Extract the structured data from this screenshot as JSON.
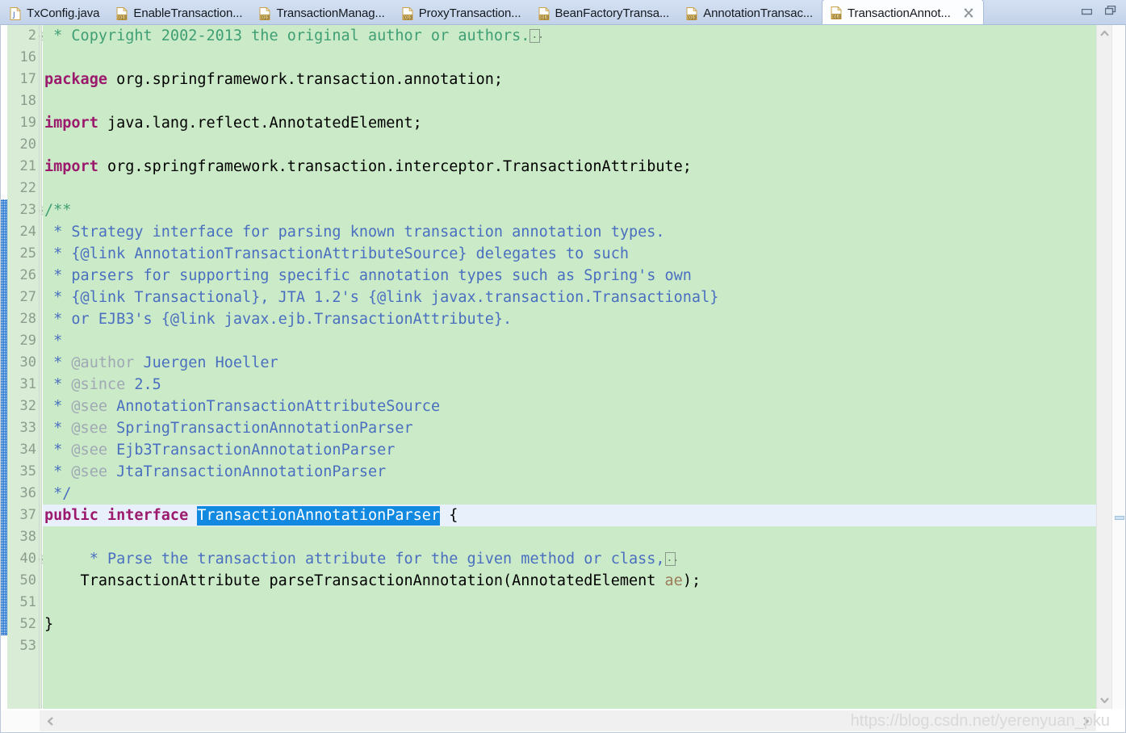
{
  "window": {
    "minimize_label": "Minimize",
    "maximize_label": "Restore"
  },
  "tabs": [
    {
      "label": "TxConfig.java",
      "icon": "java-file-icon",
      "active": false,
      "closable": false
    },
    {
      "label": "EnableTransaction...",
      "icon": "class-file-icon",
      "active": false,
      "closable": false
    },
    {
      "label": "TransactionManag...",
      "icon": "class-file-icon",
      "active": false,
      "closable": false
    },
    {
      "label": "ProxyTransaction...",
      "icon": "class-file-icon",
      "active": false,
      "closable": false
    },
    {
      "label": "BeanFactoryTransa...",
      "icon": "class-file-icon",
      "active": false,
      "closable": false
    },
    {
      "label": "AnnotationTransac...",
      "icon": "class-file-icon",
      "active": false,
      "closable": false
    },
    {
      "label": "TransactionAnnot...",
      "icon": "class-file-icon",
      "active": true,
      "closable": true
    }
  ],
  "editor": {
    "lines": [
      {
        "num": "2",
        "fold": "expand",
        "segments": [
          {
            "t": " * Copyright 2002-2013 the original author or authors.",
            "c": "cm"
          },
          {
            "t": "",
            "c": "collapsebox"
          }
        ]
      },
      {
        "num": "16",
        "fold": "",
        "segments": []
      },
      {
        "num": "17",
        "fold": "",
        "segments": [
          {
            "t": "package",
            "c": "k"
          },
          {
            "t": " org.springframework.transaction.annotation;",
            "c": "pl"
          }
        ]
      },
      {
        "num": "18",
        "fold": "",
        "segments": []
      },
      {
        "num": "19",
        "fold": "",
        "segments": [
          {
            "t": "import",
            "c": "k"
          },
          {
            "t": " java.lang.reflect.AnnotatedElement;",
            "c": "pl"
          }
        ]
      },
      {
        "num": "20",
        "fold": "",
        "segments": []
      },
      {
        "num": "21",
        "fold": "",
        "segments": [
          {
            "t": "import",
            "c": "k"
          },
          {
            "t": " org.springframework.transaction.interceptor.TransactionAttribute;",
            "c": "pl"
          }
        ]
      },
      {
        "num": "22",
        "fold": "",
        "segments": []
      },
      {
        "num": "23",
        "fold": "collapse",
        "segments": [
          {
            "t": "/**",
            "c": "cm"
          }
        ]
      },
      {
        "num": "24",
        "fold": "",
        "segments": [
          {
            "t": " * Strategy interface for parsing known transaction annotation types.",
            "c": "jd"
          }
        ]
      },
      {
        "num": "25",
        "fold": "",
        "segments": [
          {
            "t": " * {@link AnnotationTransactionAttributeSource} delegates to such",
            "c": "jd"
          }
        ]
      },
      {
        "num": "26",
        "fold": "",
        "segments": [
          {
            "t": " * parsers for supporting specific annotation types such as Spring's own",
            "c": "jd"
          }
        ]
      },
      {
        "num": "27",
        "fold": "",
        "segments": [
          {
            "t": " * {@link Transactional}, JTA 1.2's {@link javax.transaction.Transactional}",
            "c": "jd"
          }
        ]
      },
      {
        "num": "28",
        "fold": "",
        "segments": [
          {
            "t": " * or EJB3's {@link javax.ejb.TransactionAttribute}.",
            "c": "jd"
          }
        ]
      },
      {
        "num": "29",
        "fold": "",
        "segments": [
          {
            "t": " *",
            "c": "jd"
          }
        ]
      },
      {
        "num": "30",
        "fold": "",
        "segments": [
          {
            "t": " * ",
            "c": "jd"
          },
          {
            "t": "@author",
            "c": "jt"
          },
          {
            "t": " Juergen Hoeller",
            "c": "jd"
          }
        ]
      },
      {
        "num": "31",
        "fold": "",
        "segments": [
          {
            "t": " * ",
            "c": "jd"
          },
          {
            "t": "@since",
            "c": "jt"
          },
          {
            "t": " 2.5",
            "c": "jd"
          }
        ]
      },
      {
        "num": "32",
        "fold": "",
        "segments": [
          {
            "t": " * ",
            "c": "jd"
          },
          {
            "t": "@see",
            "c": "jt"
          },
          {
            "t": " AnnotationTransactionAttributeSource",
            "c": "jd"
          }
        ]
      },
      {
        "num": "33",
        "fold": "",
        "segments": [
          {
            "t": " * ",
            "c": "jd"
          },
          {
            "t": "@see",
            "c": "jt"
          },
          {
            "t": " SpringTransactionAnnotationParser",
            "c": "jd"
          }
        ]
      },
      {
        "num": "34",
        "fold": "",
        "segments": [
          {
            "t": " * ",
            "c": "jd"
          },
          {
            "t": "@see",
            "c": "jt"
          },
          {
            "t": " Ejb3TransactionAnnotationParser",
            "c": "jd"
          }
        ]
      },
      {
        "num": "35",
        "fold": "",
        "segments": [
          {
            "t": " * ",
            "c": "jd"
          },
          {
            "t": "@see",
            "c": "jt"
          },
          {
            "t": " JtaTransactionAnnotationParser",
            "c": "jd"
          }
        ]
      },
      {
        "num": "36",
        "fold": "",
        "segments": [
          {
            "t": " */",
            "c": "jd"
          }
        ]
      },
      {
        "num": "37",
        "fold": "",
        "current": true,
        "segments": [
          {
            "t": "public interface ",
            "c": "k"
          },
          {
            "t": "TransactionAnnotationParser",
            "c": "sel"
          },
          {
            "t": " {",
            "c": "pl"
          }
        ]
      },
      {
        "num": "38",
        "fold": "",
        "segments": []
      },
      {
        "num": "40",
        "fold": "expand",
        "segments": [
          {
            "t": "     * Parse the transaction attribute for the given method or class,",
            "c": "jd"
          },
          {
            "t": "",
            "c": "collapsebox"
          }
        ]
      },
      {
        "num": "50",
        "fold": "",
        "segments": [
          {
            "t": "    TransactionAttribute parseTransactionAnnotation(AnnotatedElement ",
            "c": "pl"
          },
          {
            "t": "ae",
            "c": "pm"
          },
          {
            "t": ");",
            "c": "pl"
          }
        ]
      },
      {
        "num": "51",
        "fold": "",
        "segments": []
      },
      {
        "num": "52",
        "fold": "",
        "segments": [
          {
            "t": "}",
            "c": "pl"
          }
        ]
      },
      {
        "num": "53",
        "fold": "",
        "segments": []
      }
    ],
    "background_color": "#cbeac7",
    "gutter_color": "#d8ecd6",
    "current_line_color": "#e8f1fb",
    "selection_color": "#1189e0",
    "keyword_color": "#9c1a6e",
    "javadoc_color": "#4a6fc0",
    "comment_color": "#3f9f74"
  },
  "scrollbars": {
    "vertical_up_label": "Scroll up",
    "vertical_down_label": "Scroll down",
    "horizontal_left_label": "Scroll left",
    "horizontal_right_label": "Scroll right"
  },
  "watermark": "https://blog.csdn.net/yerenyuan_pku"
}
